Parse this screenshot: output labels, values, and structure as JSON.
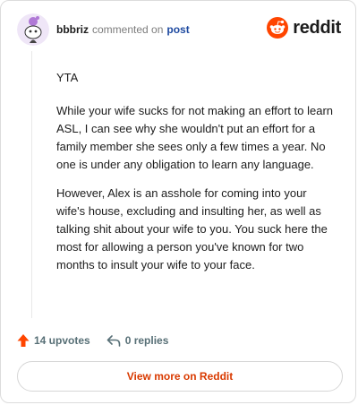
{
  "header": {
    "username": "bbbriz",
    "action": "commented on",
    "post_link": "post",
    "brand_word": "reddit",
    "avatar_icon": "snoo-avatar-icon",
    "brand_icon": "reddit-logo-icon"
  },
  "comment": {
    "paragraphs": [
      "YTA",
      "While your wife sucks for not making an effort to learn ASL, I can see why she wouldn't put an effort for a family member she sees only a few times a year. No one is under any obligation to learn any language.",
      "However, Alex is an asshole for coming into your wife's house, excluding and insulting her, as well as talking shit about your wife to you. You suck here the most for allowing a person you've known for two months to insult your wife to your face."
    ]
  },
  "footer": {
    "upvotes": "14 upvotes",
    "replies": "0 replies",
    "view_more": "View more on Reddit"
  },
  "colors": {
    "brand_orange": "#ff4500",
    "link_blue": "#1e4aa0",
    "cta_orange": "#d93a00",
    "avatar_purple": "#b079d6"
  }
}
